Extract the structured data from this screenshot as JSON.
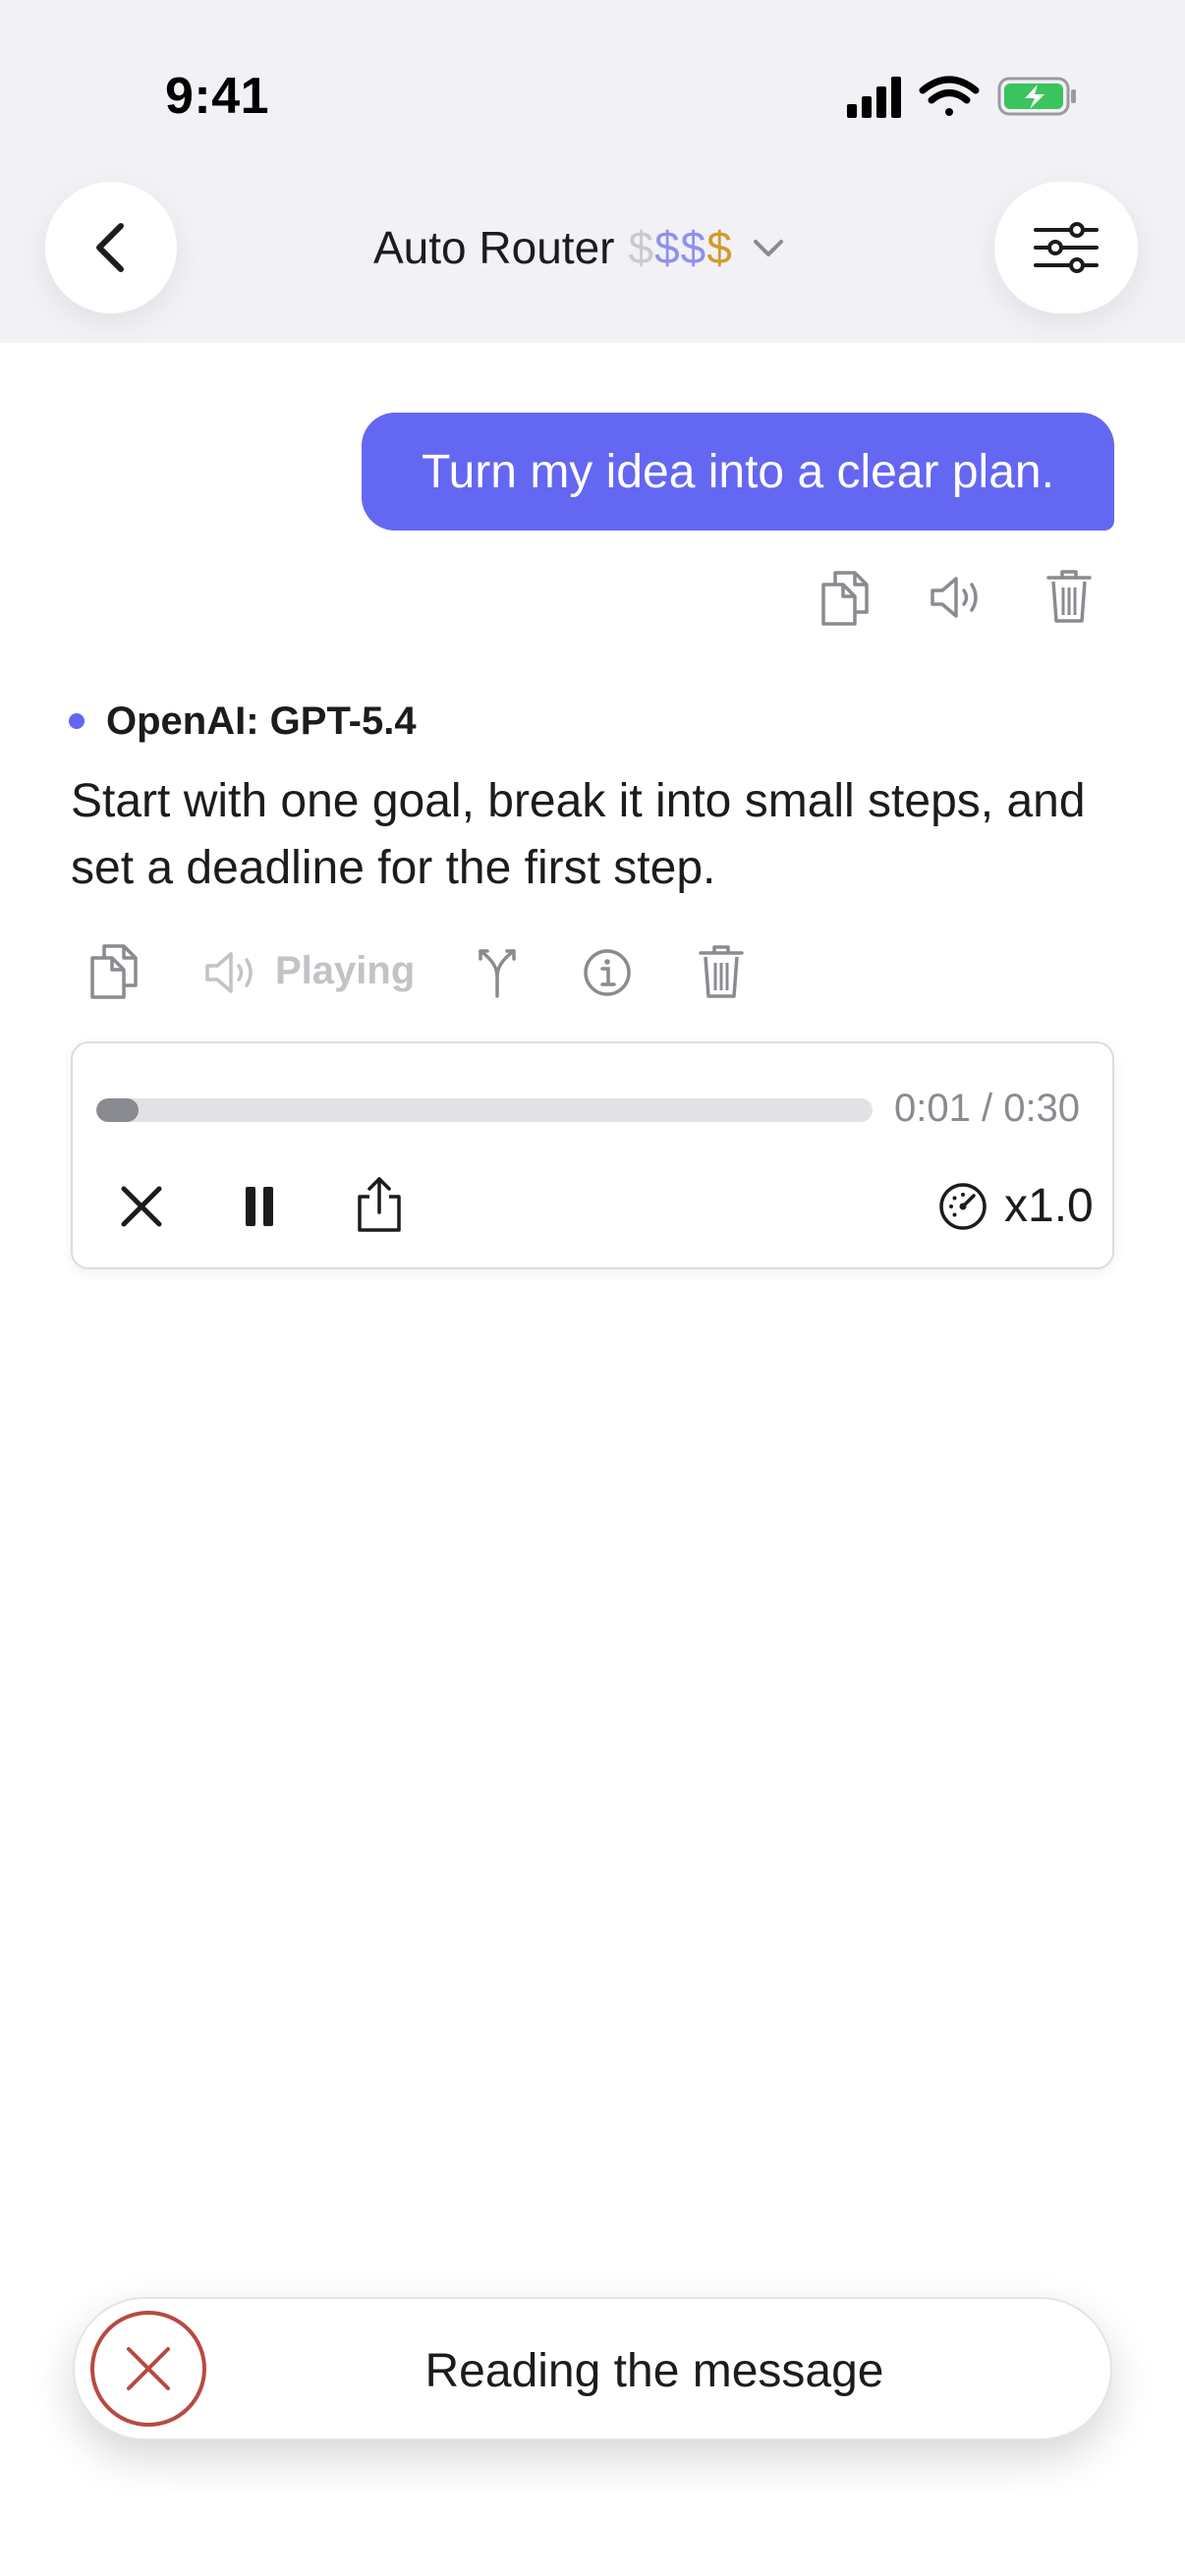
{
  "status_bar": {
    "time": "9:41"
  },
  "header": {
    "title": "Auto Router",
    "price_tier": [
      "$",
      "$",
      "$",
      "$"
    ],
    "price_tier_colors": [
      "#c9c9ce",
      "#8f90f0",
      "#8f90f0",
      "#d39a2c"
    ],
    "back_icon": "chevron-left-icon",
    "settings_icon": "sliders-icon",
    "dropdown_icon": "chevron-down-icon"
  },
  "user_message": {
    "text": "Turn my idea into a clear plan.",
    "actions": [
      "copy-icon",
      "speaker-icon",
      "trash-icon"
    ]
  },
  "assistant_message": {
    "model": "OpenAI: GPT-5.4",
    "text": "Start with one goal, break it into small steps, and set a deadline for the first step.",
    "playing_label": "Playing",
    "actions": [
      "copy-icon",
      "speaker-icon",
      "branch-icon",
      "info-icon",
      "trash-icon"
    ]
  },
  "audio_player": {
    "time": "0:01 / 0:30",
    "progress": 0.033,
    "speed": "x1.0",
    "controls": [
      "close-icon",
      "pause-icon",
      "share-icon",
      "speedometer-icon"
    ]
  },
  "toast": {
    "text": "Reading the message",
    "cancel_icon": "cancel-circle-icon"
  },
  "colors": {
    "accent": "#6467f2",
    "header_bg": "#f1f1f6",
    "cancel_red": "#b84a40",
    "muted_icon": "#8a8b91"
  }
}
